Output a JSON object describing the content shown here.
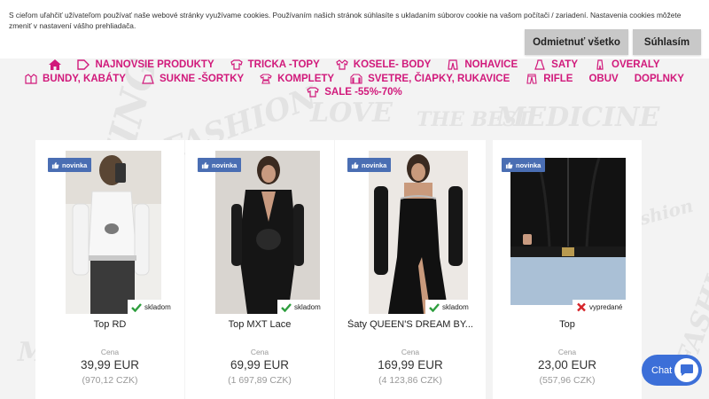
{
  "cookie": {
    "text": "S cieľom uľahčiť užívateľom používať naše webové stránky využívame cookies. Používaním našich stránok súhlasíte s ukladaním súborov cookie na vašom počítači / zariadení. Nastavenia cookies môžete zmeniť v nastavení vášho prehliadača.",
    "reject_label": "Odmietnuť všetko",
    "accept_label": "Súhlasím"
  },
  "nav": {
    "row1": [
      {
        "icon": "home-icon",
        "label": ""
      },
      {
        "icon": "tag-icon",
        "label": "NAJNOVŠIE PRODUKTY"
      },
      {
        "icon": "tshirt-icon",
        "label": "TRIČKA -TOPY"
      },
      {
        "icon": "shirt-icon",
        "label": "KOŠELE- BODY"
      },
      {
        "icon": "trousers-icon",
        "label": "NOHAVICE"
      },
      {
        "icon": "dress-icon",
        "label": "ŠATY"
      },
      {
        "icon": "overall-icon",
        "label": "OVERALY"
      }
    ],
    "row2": [
      {
        "icon": "jacket-icon",
        "label": "BUNDY, KABÁTY"
      },
      {
        "icon": "skirt-icon",
        "label": "SUKNE -ŠORTKY"
      },
      {
        "icon": "set-icon",
        "label": "KOMPLETY"
      },
      {
        "icon": "sweater-icon",
        "label": "SVETRE, ČIAPKY, RUKAVICE"
      },
      {
        "icon": "jeans-icon",
        "label": "RIFLE"
      },
      {
        "icon": "",
        "label": "OBUV"
      },
      {
        "icon": "",
        "label": "DOPLNKY"
      }
    ],
    "row3": [
      {
        "icon": "sale-shirt-icon",
        "label": "SALE -55%-70%"
      }
    ]
  },
  "products": [
    {
      "badge": "novinka",
      "stock": "skladom",
      "stock_status": "in",
      "title": "Top RD",
      "price_label": "Cena",
      "price": "39,99 EUR",
      "price_czk": "(970,12 CZK)"
    },
    {
      "badge": "novinka",
      "stock": "skladom",
      "stock_status": "in",
      "title": "Top MXT Lace",
      "price_label": "Cena",
      "price": "69,99 EUR",
      "price_czk": "(1 697,89 CZK)"
    },
    {
      "badge": "novinka",
      "stock": "skladom",
      "stock_status": "in",
      "title": "Šaty QUEEN'S DREAM BY...",
      "price_label": "Cena",
      "price": "169,99 EUR",
      "price_czk": "(4 123,86 CZK)"
    },
    {
      "badge": "novinka",
      "stock": "vypredané",
      "stock_status": "out",
      "title": "Top",
      "price_label": "Cena",
      "price": "23,00 EUR",
      "price_czk": "(557,96 CZK)"
    }
  ],
  "chat": {
    "label": "Chat"
  },
  "colors": {
    "accent": "#d1197b",
    "badge": "#4a6eb3",
    "chat": "#3c6fd8",
    "in_stock": "#2e9e3e",
    "sold_out": "#d6262b"
  }
}
